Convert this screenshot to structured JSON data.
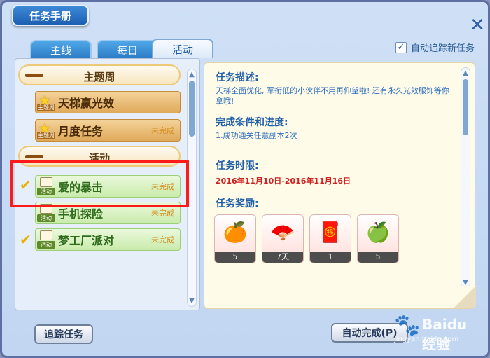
{
  "window": {
    "title": "任务手册",
    "close_label": "✕"
  },
  "tabs": [
    {
      "label": "主线",
      "active": false
    },
    {
      "label": "每日",
      "active": false
    },
    {
      "label": "活动",
      "active": true
    }
  ],
  "auto_track": {
    "label": "自动追踪新任务",
    "checked": true,
    "check_mark": "✓"
  },
  "sidebar": {
    "groups": [
      {
        "label": "主题周",
        "items": [
          {
            "badge": "主题周",
            "label": "天梯赢光效",
            "status": ""
          },
          {
            "badge": "主题周",
            "label": "月度任务",
            "status": "未完成"
          }
        ]
      },
      {
        "label": "活动",
        "items": [
          {
            "badge": "活动",
            "label": "爱的暴击",
            "status": "未完成",
            "tracked": true
          },
          {
            "badge": "活动",
            "label": "手机探险",
            "status": "未完成",
            "tracked": false
          },
          {
            "badge": "活动",
            "label": "梦工厂派对",
            "status": "未完成",
            "tracked": true
          }
        ]
      }
    ],
    "check_mark": "✔"
  },
  "detail": {
    "desc_title": "任务描述:",
    "desc_text": "天梯全面优化, 军衔低的小伙伴不用再仰望啦! 还有永久光效服饰等你拿哦!",
    "cond_title": "完成条件和进度:",
    "cond_text": "1.成功通关任意副本2次",
    "time_title": "任务时限:",
    "time_text": "2016年11月10日-2016年11月16日",
    "reward_title": "任务奖励:",
    "rewards": [
      {
        "icon": "orange-fruit-icon",
        "glyph": "🍊",
        "count": "5"
      },
      {
        "icon": "fan-icon",
        "glyph": "🪭",
        "count": "7天"
      },
      {
        "icon": "red-envelope-icon",
        "glyph": "🧧",
        "count": "1"
      },
      {
        "icon": "growth-apple-icon",
        "glyph": "🍏",
        "count": "5"
      }
    ]
  },
  "buttons": {
    "track": "追踪任务",
    "auto_complete": "自动完成(P)"
  },
  "watermark": {
    "text": "Baidu 经验",
    "url": "jingyan.baidu.com",
    "paw": "🐾"
  }
}
